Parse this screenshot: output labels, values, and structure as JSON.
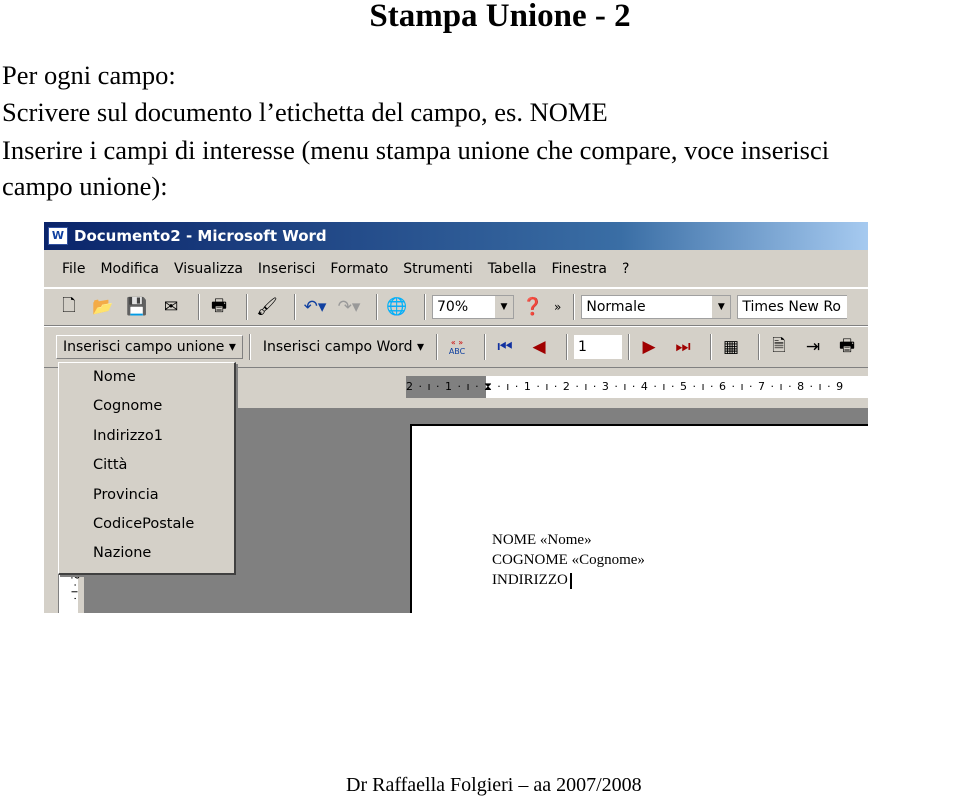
{
  "slide": {
    "title": "Stampa Unione - 2",
    "lines": [
      "Per ogni campo:",
      "Scrivere sul documento l’etichetta del campo, es. NOME",
      "Inserire i campi di interesse (menu stampa unione che compare, voce inserisci",
      "campo unione):"
    ],
    "footer": "Dr Raffaella Folgieri – aa 2007/2008"
  },
  "window": {
    "title": "Documento2 - Microsoft Word",
    "icon": "W",
    "menu": [
      "File",
      "Modifica",
      "Visualizza",
      "Inserisci",
      "Formato",
      "Strumenti",
      "Tabella",
      "Finestra",
      "?"
    ],
    "toolbar": {
      "zoom": "70%",
      "style": "Normale",
      "font": "Times New Ro"
    },
    "mailmerge": {
      "insert_merge_field": "Inserisci campo unione",
      "insert_word_field": "Inserisci campo Word",
      "record": "1",
      "abc": "ABC"
    },
    "ruler": "2 · ı · 1 · ı · ⧗ · ı · 1 · ı · 2 · ı · 3 · ı · 4 · ı · 5 · ı · 6 · ı · 7 · ı · 8 · ı · 9",
    "vruler": "2 · ı ·",
    "dropdown": [
      "Nome",
      "Cognome",
      "Indirizzo1",
      "Città",
      "Provincia",
      "CodicePostale",
      "Nazione"
    ],
    "document": [
      "NOME «Nome»",
      "COGNOME «Cognome»",
      "INDIRIZZO"
    ]
  }
}
